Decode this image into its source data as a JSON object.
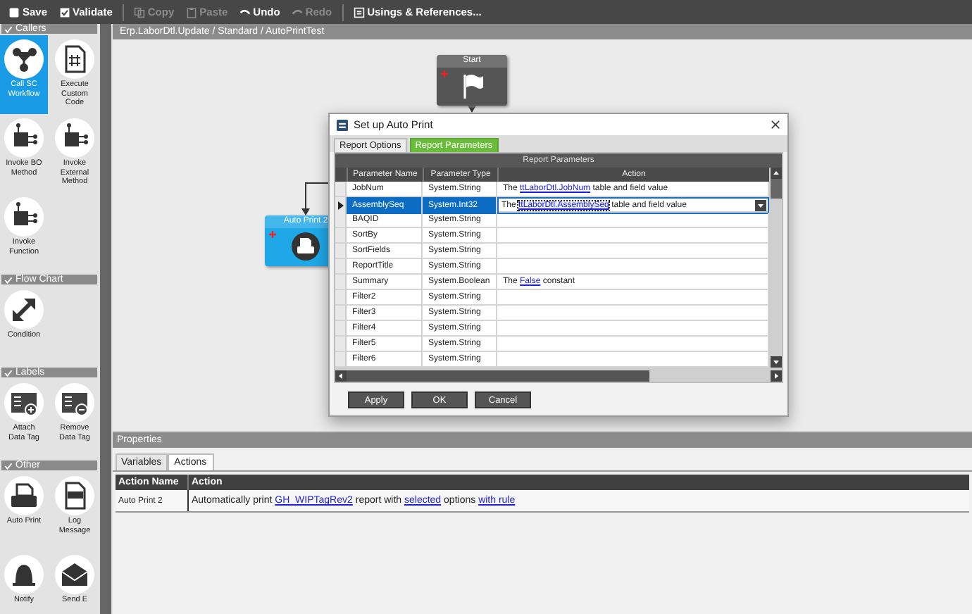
{
  "toolbar": [
    {
      "label": "Save",
      "disabled": false
    },
    {
      "label": "Validate",
      "disabled": false
    },
    {
      "label": "Copy",
      "disabled": true
    },
    {
      "label": "Paste",
      "disabled": true
    },
    {
      "label": "Undo",
      "disabled": false
    },
    {
      "label": "Redo",
      "disabled": true
    },
    {
      "label": "Usings & References...",
      "disabled": false
    }
  ],
  "sidebar": {
    "sections": [
      {
        "title": "Callers",
        "expanded": true,
        "items": [
          {
            "label": "Call SC\nWorkflow",
            "selected": true
          },
          {
            "label": "Execute\nCustom\nCode",
            "selected": false
          },
          {
            "label": "Invoke BO\nMethod",
            "selected": false
          },
          {
            "label": "Invoke\nExternal\nMethod",
            "selected": false
          },
          {
            "label": "Invoke\nFunction",
            "selected": false
          }
        ]
      },
      {
        "title": "Flow Chart",
        "expanded": true,
        "items": [
          {
            "label": "Condition",
            "selected": false
          }
        ]
      },
      {
        "title": "Labels",
        "expanded": true,
        "items": [
          {
            "label": "Attach\nData Tag",
            "selected": false
          },
          {
            "label": "Remove\nData Tag",
            "selected": false
          }
        ]
      },
      {
        "title": "Other",
        "expanded": true,
        "items": [
          {
            "label": "Auto Print",
            "selected": false
          },
          {
            "label": "Log\nMessage",
            "selected": false
          },
          {
            "label": "Notify",
            "selected": false
          },
          {
            "label": "Send E",
            "selected": false
          }
        ]
      }
    ]
  },
  "breadcrumb": "Erp.LaborDtl.Update / Standard / AutoPrintTest",
  "canvas": {
    "nodes": [
      {
        "title": "Start",
        "kind": "start"
      },
      {
        "title": "Auto Print 2",
        "kind": "print"
      }
    ]
  },
  "dialog": {
    "title": "Set up Auto Print",
    "tabs": [
      {
        "label": "Report Options",
        "selected": false
      },
      {
        "label": "Report Parameters",
        "selected": true
      }
    ],
    "grid_title": "Report Parameters",
    "columns": [
      "Parameter Name",
      "Parameter Type",
      "Action"
    ],
    "rows": [
      {
        "name": "JobNum",
        "type": "System.String",
        "selected": false,
        "action": [
          {
            "text": "The",
            "link": false
          },
          {
            "text": "ttLaborDtl.JobNum",
            "link": true
          },
          {
            "text": "table and field value",
            "link": false
          }
        ]
      },
      {
        "name": "AssemblySeq",
        "type": "System.Int32",
        "selected": true,
        "action": [
          {
            "text": "The",
            "link": false
          },
          {
            "text": "ttLaborDtl.AssemblySeq",
            "link": true
          },
          {
            "text": "table and field value",
            "link": false
          }
        ]
      },
      {
        "name": "BAQID",
        "type": "System.String",
        "selected": false,
        "action": []
      },
      {
        "name": "SortBy",
        "type": "System.String",
        "selected": false,
        "action": []
      },
      {
        "name": "SortFields",
        "type": "System.String",
        "selected": false,
        "action": []
      },
      {
        "name": "ReportTitle",
        "type": "System.String",
        "selected": false,
        "action": []
      },
      {
        "name": "Summary",
        "type": "System.Boolean",
        "selected": false,
        "action": [
          {
            "text": "The",
            "link": false
          },
          {
            "text": "False",
            "link": true
          },
          {
            "text": "constant",
            "link": false
          }
        ]
      },
      {
        "name": "Filter2",
        "type": "System.String",
        "selected": false,
        "action": []
      },
      {
        "name": "Filter3",
        "type": "System.String",
        "selected": false,
        "action": []
      },
      {
        "name": "Filter4",
        "type": "System.String",
        "selected": false,
        "action": []
      },
      {
        "name": "Filter5",
        "type": "System.String",
        "selected": false,
        "action": []
      },
      {
        "name": "Filter6",
        "type": "System.String",
        "selected": false,
        "action": []
      }
    ],
    "buttons": [
      "Apply",
      "OK",
      "Cancel"
    ]
  },
  "properties": {
    "title": "Properties",
    "tabs": [
      {
        "label": "Variables",
        "selected": false
      },
      {
        "label": "Actions",
        "selected": true
      }
    ],
    "columns": [
      "Action Name",
      "Action"
    ],
    "rows": [
      {
        "name": "Auto Print 2",
        "action": [
          {
            "text": "Automatically print",
            "link": false
          },
          {
            "text": "GH_WIPTagRev2",
            "link": true
          },
          {
            "text": "report with",
            "link": false
          },
          {
            "text": "selected",
            "link": true
          },
          {
            "text": "options",
            "link": false
          },
          {
            "text": "with rule",
            "link": true
          }
        ]
      }
    ]
  }
}
